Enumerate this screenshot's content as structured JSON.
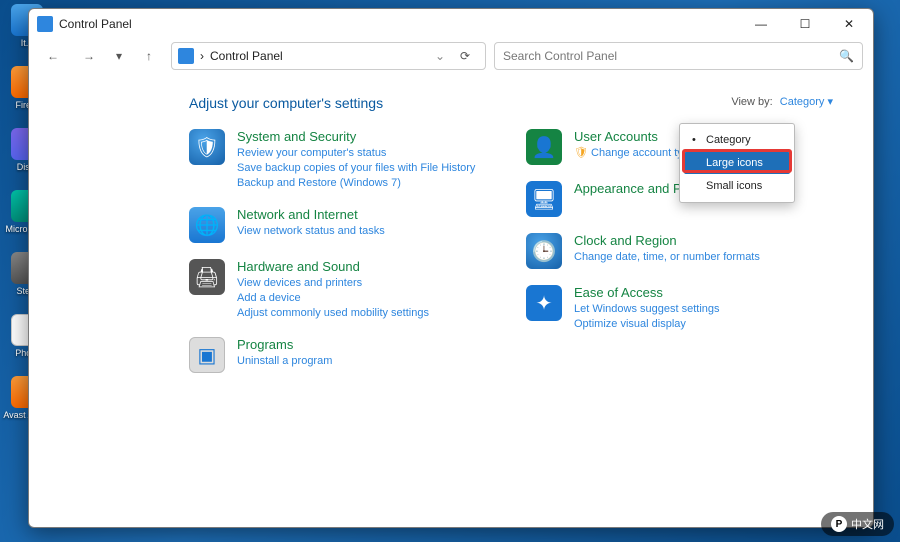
{
  "window": {
    "title": "Control Panel",
    "breadcrumb_label": "Control Panel",
    "search_placeholder": "Search Control Panel"
  },
  "desktop_icons": [
    {
      "label": "It..."
    },
    {
      "label": "Fire..."
    },
    {
      "label": "Dis..."
    },
    {
      "label": "Micro\nEd..."
    },
    {
      "label": "Ste..."
    },
    {
      "label": "Pho..."
    },
    {
      "label": "Avast\nAnti..."
    }
  ],
  "heading": "Adjust your computer's settings",
  "viewby": {
    "label": "View by:",
    "value": "Category"
  },
  "menu": {
    "items": [
      "Category",
      "Large icons",
      "Small icons"
    ],
    "selected": "Category",
    "highlighted": "Large icons"
  },
  "categories_left": [
    {
      "title": "System and Security",
      "links": [
        "Review your computer's status",
        "Save backup copies of your files with File History",
        "Backup and Restore (Windows 7)"
      ],
      "icon": "shield-icon"
    },
    {
      "title": "Network and Internet",
      "links": [
        "View network status and tasks"
      ],
      "icon": "globe-icon"
    },
    {
      "title": "Hardware and Sound",
      "links": [
        "View devices and printers",
        "Add a device",
        "Adjust commonly used mobility settings"
      ],
      "icon": "printer-icon"
    },
    {
      "title": "Programs",
      "links": [
        "Uninstall a program"
      ],
      "icon": "programs-icon"
    }
  ],
  "categories_right": [
    {
      "title": "User Accounts",
      "links": [
        "Change account type"
      ],
      "icon": "user-icon",
      "shield_on_link": true
    },
    {
      "title": "Appearance and Personalization",
      "links": [],
      "icon": "monitor-icon"
    },
    {
      "title": "Clock and Region",
      "links": [
        "Change date, time, or number formats"
      ],
      "icon": "clock-icon"
    },
    {
      "title": "Ease of Access",
      "links": [
        "Let Windows suggest settings",
        "Optimize visual display"
      ],
      "icon": "ease-icon"
    }
  ],
  "watermark": "中文网"
}
